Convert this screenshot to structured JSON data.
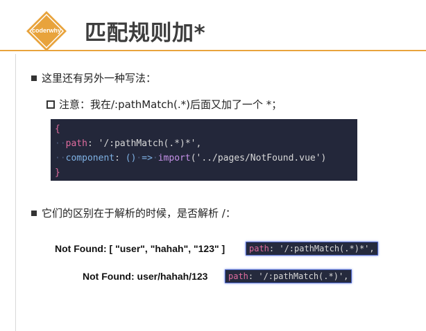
{
  "logo": {
    "text": "coderwhy",
    "color": "#e8a33c"
  },
  "title": "匹配规则加*",
  "bullets": {
    "b1": "这里还有另外一种写法：",
    "b2": "注意：我在/:pathMatch(.*)后面又加了一个 *；",
    "b3": "它们的区别在于解析的时候，是否解析 /："
  },
  "code": {
    "open": "{",
    "l1_key": "path",
    "l1_colon": ": ",
    "l1_val": "'/:pathMatch(.*)*'",
    "l1_end": ",",
    "l2_key": "component",
    "l2_colon": ": ",
    "l2_parens": "()",
    "l2_arrow": "=>",
    "l2_fn": "import",
    "l2_arg": "('../pages/NotFound.vue')",
    "close": "}"
  },
  "examples": {
    "ex1_label": "Not Found: [ \"user\", \"hahah\", \"123\" ]",
    "ex1_key": "path",
    "ex1_val": ": '/:pathMatch(.*)*',",
    "ex2_label": "Not Found: user/hahah/123",
    "ex2_key": "path",
    "ex2_val": ": '/:pathMatch(.*)',"
  }
}
